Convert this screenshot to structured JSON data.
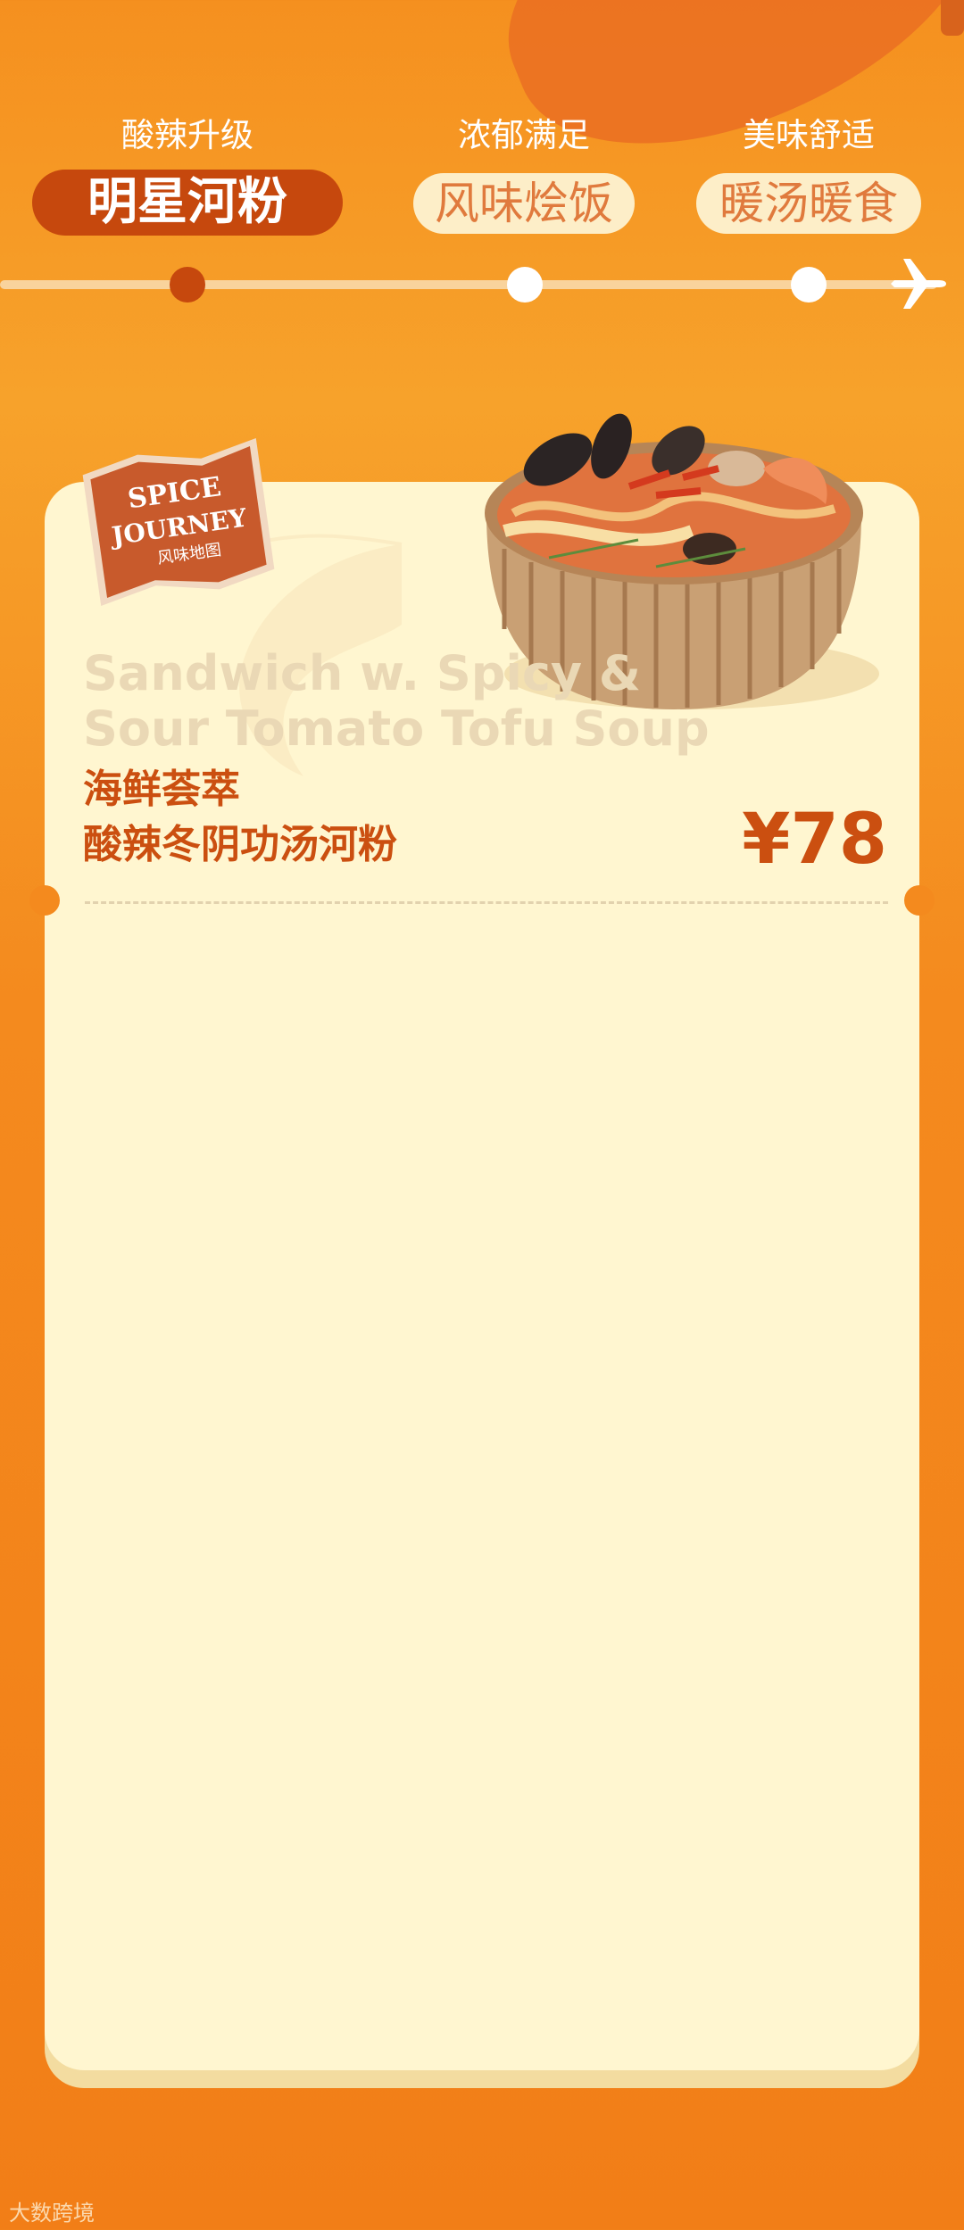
{
  "tabs": [
    {
      "subtitle": "酸辣升级",
      "label": "明星河粉",
      "active": true
    },
    {
      "subtitle": "浓郁满足",
      "label": "风味烩饭",
      "active": false
    },
    {
      "subtitle": "美味舒适",
      "label": "暖汤暖食",
      "active": false
    }
  ],
  "badge": {
    "line1": "SPICE",
    "line2": "JOURNEY",
    "line3": "风味地图"
  },
  "item": {
    "name_en": "Sandwich w. Spicy & Sour Tomato Tofu Soup",
    "name_cn_line1": "海鲜荟萃",
    "name_cn_line2": "酸辣冬阴功汤河粉",
    "price": "¥78"
  },
  "footer": {
    "watermark": "大数跨境"
  },
  "colors": {
    "accent": "#cb4f10",
    "card": "#fff6d0",
    "background": "#f48a1e"
  },
  "icons": {
    "plane": "plane-icon",
    "bowl": "soup-bowl-image",
    "shrimp": "shrimp-watermark"
  }
}
